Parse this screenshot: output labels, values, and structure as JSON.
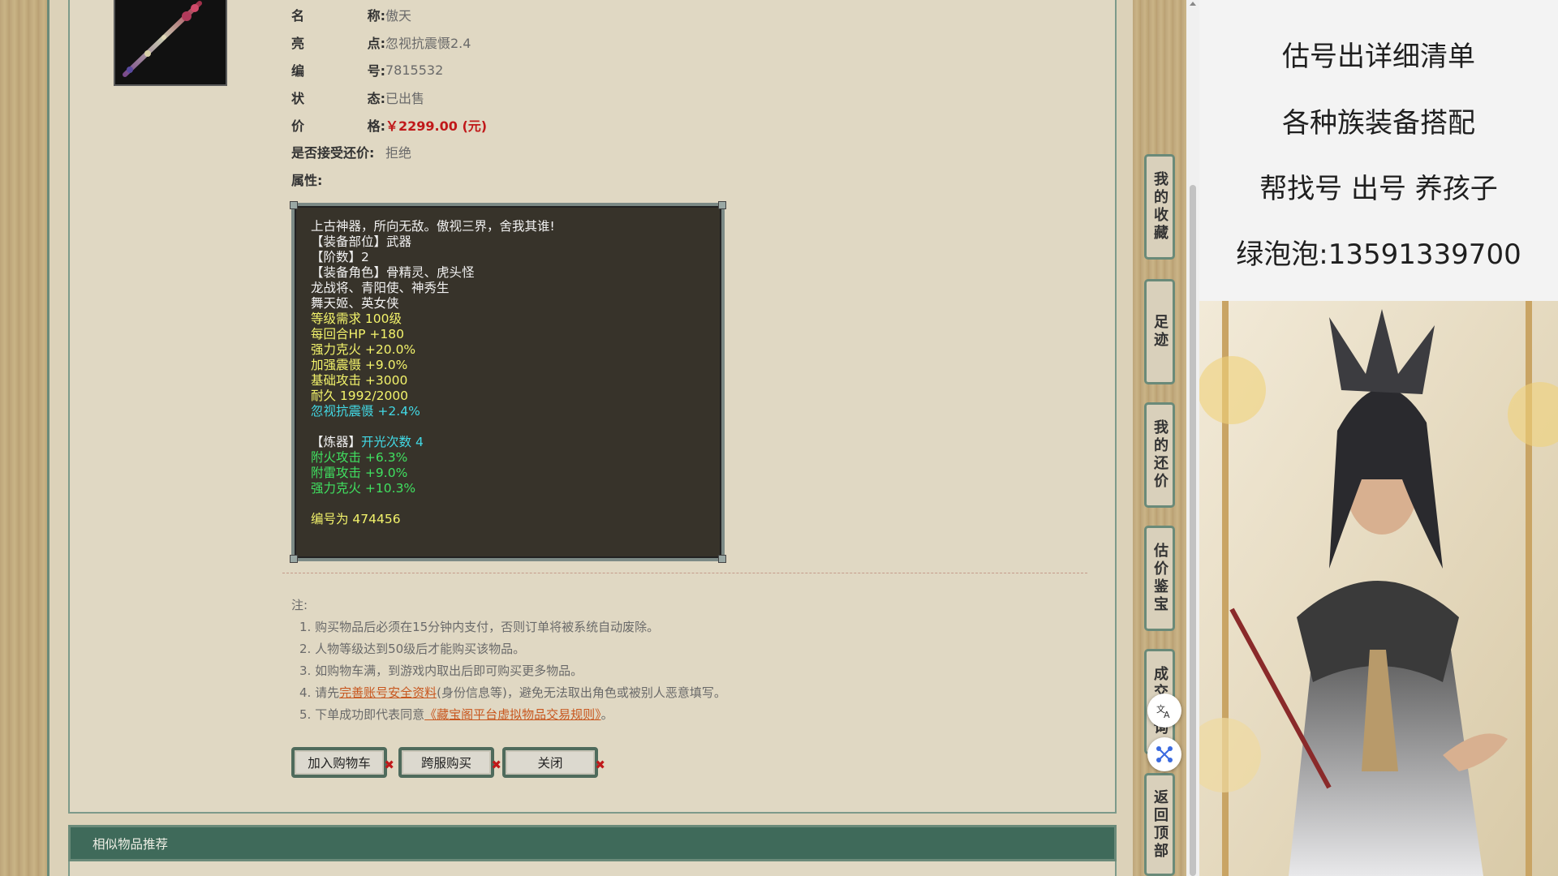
{
  "item": {
    "fields": [
      {
        "label_a": "名",
        "label_b": "称:",
        "value": "傲天"
      },
      {
        "label_a": "亮",
        "label_b": "点:",
        "value": "忽视抗震慑2.4"
      },
      {
        "label_a": "编",
        "label_b": "号:",
        "value": "7815532"
      },
      {
        "label_a": "状",
        "label_b": "态:",
        "value": "已出售"
      },
      {
        "label_a": "价",
        "label_b": "格:",
        "value": "￥2299.00 (元)"
      },
      {
        "label_a": "是否接受还价:",
        "label_b": "",
        "value": "拒绝"
      },
      {
        "label_a": "属性:",
        "label_b": "",
        "value": ""
      }
    ]
  },
  "attributes": [
    {
      "text": "上古神器，所向无敌。傲视三界，舍我其谁!",
      "color": "white"
    },
    {
      "text": "【装备部位】武器",
      "color": "white"
    },
    {
      "text": "【阶数】2",
      "color": "white"
    },
    {
      "text": "【装备角色】骨精灵、虎头怪",
      "color": "white"
    },
    {
      "text": "龙战将、青阳使、神秀生",
      "color": "white"
    },
    {
      "text": "舞天姬、英女侠",
      "color": "white"
    },
    {
      "text": "等级需求 100级",
      "color": "yellow"
    },
    {
      "text": "每回合HP +180",
      "color": "yellow"
    },
    {
      "text": "强力克火 +20.0%",
      "color": "yellow"
    },
    {
      "text": "加强震慑 +9.0%",
      "color": "yellow"
    },
    {
      "text": "基础攻击 +3000",
      "color": "yellow"
    },
    {
      "text": "耐久 1992/2000",
      "color": "yellow"
    },
    {
      "text": "忽视抗震慑 +2.4%",
      "color": "cyan"
    },
    {
      "text": "",
      "color": "white"
    },
    {
      "text": "【炼器】",
      "color": "white",
      "extra": "开光次数 4",
      "extra_color": "cyan"
    },
    {
      "text": "附火攻击 +6.3%",
      "color": "green"
    },
    {
      "text": "附雷攻击 +9.0%",
      "color": "green"
    },
    {
      "text": "强力克火 +10.3%",
      "color": "green"
    },
    {
      "text": "",
      "color": "white"
    },
    {
      "text": "编号为 474456",
      "color": "yellow"
    }
  ],
  "notes": {
    "title": "注:",
    "n1": "1. 购买物品后必须在15分钟内支付，否则订单将被系统自动废除。",
    "n2": "2. 人物等级达到50级后才能购买该物品。",
    "n3": "3. 如购物车满，到游戏内取出后即可购买更多物品。",
    "n4_pre": "4. 请先",
    "n4_link": "完善账号安全资料",
    "n4_post": "(身份信息等)，避免无法取出角色或被别人恶意填写。",
    "n5_pre": "5. 下单成功即代表同意",
    "n5_link": "《藏宝阁平台虚拟物品交易规则》",
    "n5_post": "。"
  },
  "buttons": {
    "add_cart": "加入购物车",
    "cross_buy": "跨服购买",
    "close": "关闭",
    "x_mark": "✖"
  },
  "similar": {
    "title": "相似物品推荐"
  },
  "rail": {
    "favorites": "我的收藏",
    "footprint": "足迹",
    "my_bargain": "我的还价",
    "appraise": "估价鉴宝",
    "deal_query": "成交查询",
    "back_top": "返回顶部"
  },
  "promo": {
    "line1": "估号出详细清单",
    "line2": "各种族装备搭配",
    "line3": "帮找号 出号 养孩子",
    "line4": "绿泡泡:13591339700"
  },
  "colors": {
    "price": "#c0191a",
    "panel_green": "#3f6a5a",
    "attr_bg": "#37332a"
  },
  "icons": {
    "translate": "translate-icon",
    "network": "network-icon",
    "close_x": "close-x-icon"
  }
}
